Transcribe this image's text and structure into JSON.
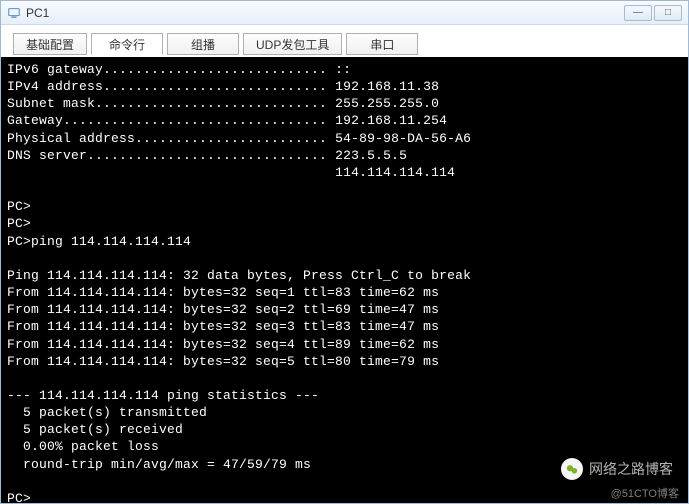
{
  "window": {
    "title": "PC1"
  },
  "tabs": [
    {
      "label": "基础配置"
    },
    {
      "label": "命令行"
    },
    {
      "label": "组播"
    },
    {
      "label": "UDP发包工具"
    },
    {
      "label": "串口"
    }
  ],
  "terminal": {
    "netinfo": {
      "ipv6_gateway_label": "IPv6 gateway",
      "ipv6_gateway_value": "::",
      "ipv4_address_label": "IPv4 address",
      "ipv4_address_value": "192.168.11.38",
      "subnet_mask_label": "Subnet mask",
      "subnet_mask_value": "255.255.255.0",
      "gateway_label": "Gateway",
      "gateway_value": "192.168.11.254",
      "physical_address_label": "Physical address",
      "physical_address_value": "54-89-98-DA-56-A6",
      "dns_server_label": "DNS server",
      "dns_server_value1": "223.5.5.5",
      "dns_server_value2": "114.114.114.114"
    },
    "prompt1": "PC>",
    "prompt2": "PC>",
    "cmd_line": "PC>ping 114.114.114.114",
    "ping": {
      "header": "Ping 114.114.114.114: 32 data bytes, Press Ctrl_C to break",
      "replies": [
        "From 114.114.114.114: bytes=32 seq=1 ttl=83 time=62 ms",
        "From 114.114.114.114: bytes=32 seq=2 ttl=69 time=47 ms",
        "From 114.114.114.114: bytes=32 seq=3 ttl=83 time=47 ms",
        "From 114.114.114.114: bytes=32 seq=4 ttl=89 time=62 ms",
        "From 114.114.114.114: bytes=32 seq=5 ttl=80 time=79 ms"
      ],
      "stats_header": "--- 114.114.114.114 ping statistics ---",
      "stats_tx": "  5 packet(s) transmitted",
      "stats_rx": "  5 packet(s) received",
      "stats_loss": "  0.00% packet loss",
      "stats_rtt": "  round-trip min/avg/max = 47/59/79 ms"
    },
    "prompt3": "PC>"
  },
  "watermark": {
    "text": "网络之路博客",
    "copyright": "@51CTO博客"
  }
}
